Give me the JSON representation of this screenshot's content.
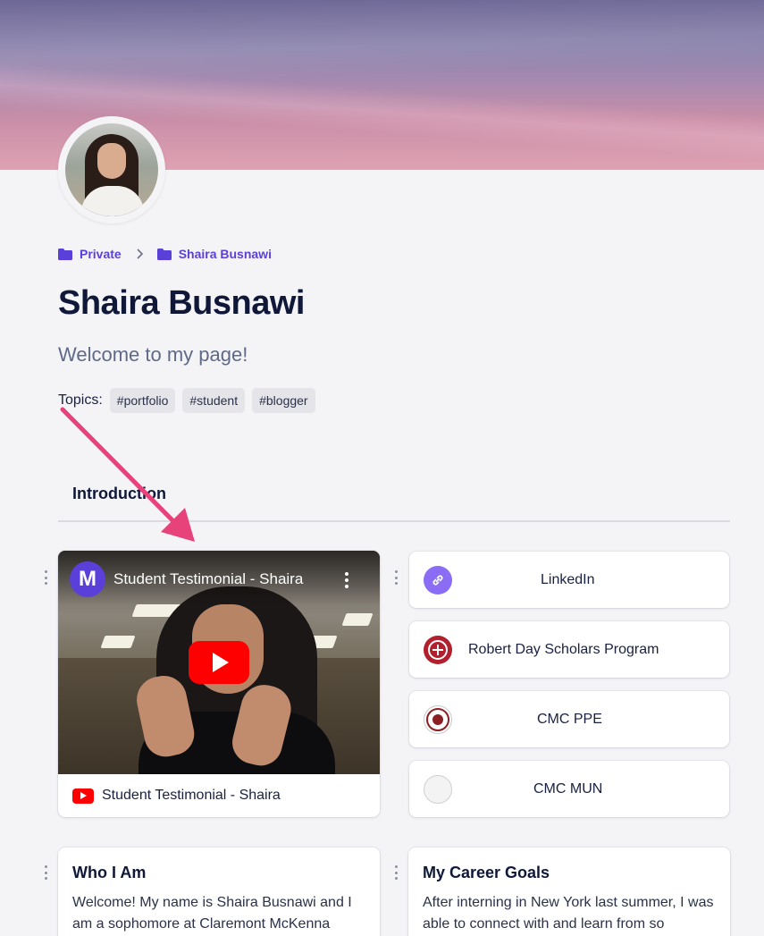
{
  "profile": {
    "name": "Shaira Busnawi",
    "subtitle": "Welcome to my page!",
    "breadcrumb": [
      "Private",
      "Shaira Busnawi"
    ],
    "topics_label": "Topics:",
    "topics": [
      "#portfolio",
      "#student",
      "#blogger"
    ]
  },
  "tabs": {
    "introduction": "Introduction"
  },
  "video": {
    "title": "Student Testimonial - Shaira",
    "channel_letter": "M",
    "caption": "Student Testimonial - Shaira"
  },
  "links": [
    {
      "label": "LinkedIn",
      "icon": "link-icon"
    },
    {
      "label": "Robert Day Scholars Program",
      "icon": "robert-day-logo"
    },
    {
      "label": "CMC PPE",
      "icon": "cmc-ppe-logo"
    },
    {
      "label": "CMC MUN",
      "icon": "broken-image-icon"
    }
  ],
  "cards": {
    "who_i_am": {
      "title": "Who I Am",
      "body": "Welcome! My name is Shaira Busnawi and I am a sophomore at Claremont McKenna"
    },
    "career_goals": {
      "title": "My Career Goals",
      "body": "After interning in New York last summer, I was able to connect with and learn from so"
    }
  },
  "colors": {
    "accent": "#5b3fd9",
    "annotation_arrow": "#e8427a",
    "youtube_red": "#ff0000"
  }
}
